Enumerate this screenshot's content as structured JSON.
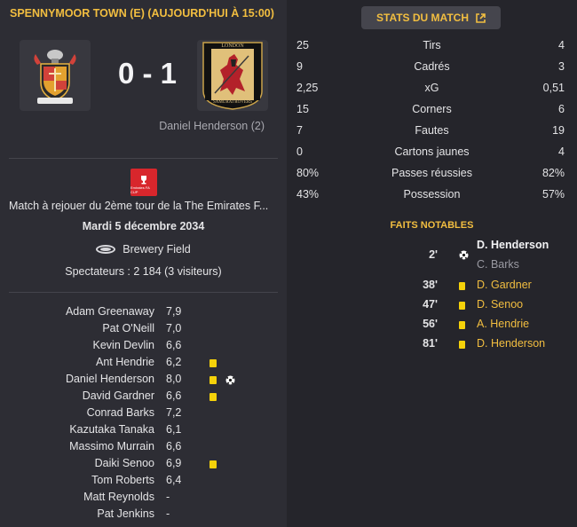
{
  "header": {
    "match_title": "SPENNYMOOR TOWN (E) (AUJOURD'HUI À 15:00)"
  },
  "score": {
    "home": "0",
    "separator": "-",
    "away": "1",
    "scorer_line": "Daniel Henderson (2)"
  },
  "away_crest": {
    "top_text": "LONDON",
    "bottom_text": "SAMURAI ROVERS"
  },
  "competition": {
    "logo_text": "Emirates FA CUP",
    "description": "Match à rejouer du 2ème tour de la The Emirates F...",
    "date": "Mardi 5 décembre 2034"
  },
  "venue": {
    "stadium": "Brewery Field",
    "attendance": "Spectateurs : 2 184 (3 visiteurs)"
  },
  "players": [
    {
      "name": "Adam Greenaway",
      "rating": "7,9",
      "yellow": false,
      "goal": false
    },
    {
      "name": "Pat O'Neill",
      "rating": "7,0",
      "yellow": false,
      "goal": false
    },
    {
      "name": "Kevin Devlin",
      "rating": "6,6",
      "yellow": false,
      "goal": false
    },
    {
      "name": "Ant Hendrie",
      "rating": "6,2",
      "yellow": true,
      "goal": false
    },
    {
      "name": "Daniel Henderson",
      "rating": "8,0",
      "yellow": true,
      "goal": true
    },
    {
      "name": "David Gardner",
      "rating": "6,6",
      "yellow": true,
      "goal": false
    },
    {
      "name": "Conrad Barks",
      "rating": "7,2",
      "yellow": false,
      "goal": false
    },
    {
      "name": "Kazutaka Tanaka",
      "rating": "6,1",
      "yellow": false,
      "goal": false
    },
    {
      "name": "Massimo Murrain",
      "rating": "6,6",
      "yellow": false,
      "goal": false
    },
    {
      "name": "Daiki Senoo",
      "rating": "6,9",
      "yellow": true,
      "goal": false
    },
    {
      "name": "Tom Roberts",
      "rating": "6,4",
      "yellow": false,
      "goal": false
    },
    {
      "name": "Matt Reynolds",
      "rating": "-",
      "yellow": false,
      "goal": false
    },
    {
      "name": "Pat Jenkins",
      "rating": "-",
      "yellow": false,
      "goal": false
    }
  ],
  "stats_button": {
    "label": "STATS DU MATCH",
    "icon": "external-link-icon"
  },
  "stats": [
    {
      "home": "25",
      "label": "Tirs",
      "away": "4"
    },
    {
      "home": "9",
      "label": "Cadrés",
      "away": "3"
    },
    {
      "home": "2,25",
      "label": "xG",
      "away": "0,51"
    },
    {
      "home": "15",
      "label": "Corners",
      "away": "6"
    },
    {
      "home": "7",
      "label": "Fautes",
      "away": "19"
    },
    {
      "home": "0",
      "label": "Cartons jaunes",
      "away": "4"
    },
    {
      "home": "80%",
      "label": "Passes réussies",
      "away": "82%"
    },
    {
      "home": "43%",
      "label": "Possession",
      "away": "57%"
    }
  ],
  "notable": {
    "title": "FAITS NOTABLES",
    "events": [
      {
        "minute": "2'",
        "type": "goal",
        "player": "D. Henderson",
        "assist": "C. Barks"
      },
      {
        "minute": "38'",
        "type": "yellow",
        "player": "D. Gardner"
      },
      {
        "minute": "47'",
        "type": "yellow",
        "player": "D. Senoo"
      },
      {
        "minute": "56'",
        "type": "yellow",
        "player": "A. Hendrie"
      },
      {
        "minute": "81'",
        "type": "yellow",
        "player": "D. Henderson"
      }
    ]
  },
  "colors": {
    "accent": "#f2be40",
    "yellow_card": "#f5d20a",
    "fa_cup_red": "#d8262c"
  }
}
